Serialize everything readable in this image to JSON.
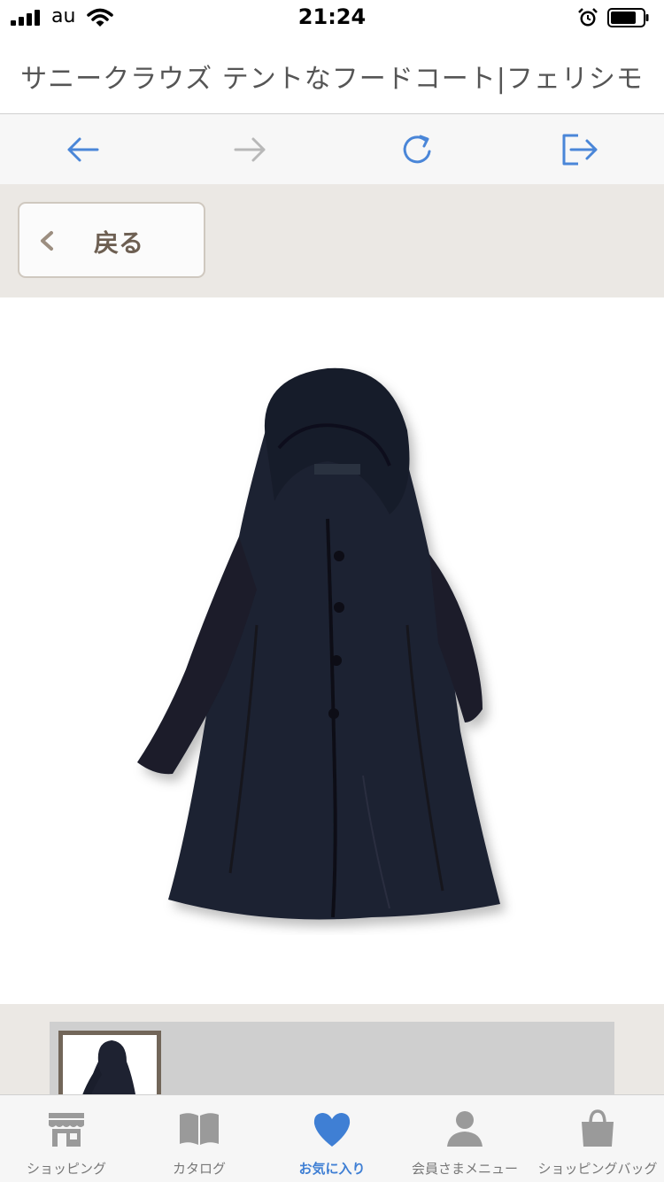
{
  "status_bar": {
    "carrier": "au",
    "time": "21:24"
  },
  "title_bar": {
    "title": "サニークラウズ テントなフードコート|フェリシモ"
  },
  "browser_toolbar": {
    "buttons": [
      "back-arrow-icon",
      "forward-arrow-icon",
      "reload-icon",
      "share-exit-icon"
    ],
    "active_color": "#4a86d8",
    "disabled_color": "#b8b8b8"
  },
  "back_button": {
    "label": "戻る"
  },
  "product": {
    "image": "hooded-coat-photo"
  },
  "tab_bar": {
    "tabs": [
      {
        "label": "ショッピング",
        "icon": "shop-icon",
        "active": false
      },
      {
        "label": "カタログ",
        "icon": "catalog-book-icon",
        "active": false
      },
      {
        "label": "お気に入り",
        "icon": "heart-icon",
        "active": true
      },
      {
        "label": "会員さまメニュー",
        "icon": "member-person-icon",
        "active": false
      },
      {
        "label": "ショッピングバッグ",
        "icon": "shopping-bag-icon",
        "active": false
      }
    ],
    "active_color": "#3f7fd4",
    "inactive_color": "#9a9a9a"
  }
}
